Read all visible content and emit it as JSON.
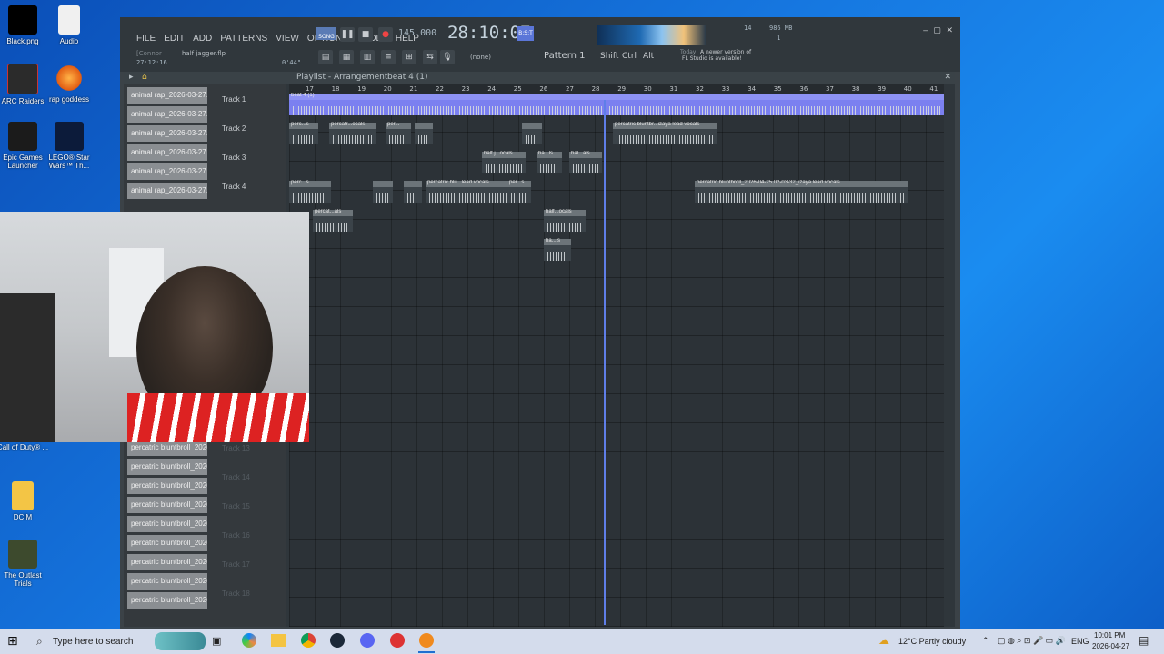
{
  "desktop": {
    "icons": [
      {
        "label": "Black.png"
      },
      {
        "label": "Audio"
      },
      {
        "label": "ARC Raiders"
      },
      {
        "label": "rap goddess"
      },
      {
        "label": "Epic Games Launcher"
      },
      {
        "label": "LEGO® Star Wars™ Th..."
      },
      {
        "label": "Call of Duty® ..."
      },
      {
        "label": "DCIM"
      },
      {
        "label": "The Outlast Trials"
      }
    ]
  },
  "flstudio": {
    "menu": [
      "FILE",
      "EDIT",
      "ADD",
      "PATTERNS",
      "VIEW",
      "OPTIONS",
      "TOOLS",
      "HELP"
    ],
    "song_label": "SONG",
    "tempo": "145.000",
    "time": "28:10:07",
    "bst": "B:S:T",
    "cpu_value": "14",
    "ram_value": "986 MB",
    "voices_value": "1",
    "user_hint": "[Connor",
    "project_file": "half jagger.flp",
    "elapsed": "27:12:16",
    "length": "0'44\"",
    "snap": "(none)",
    "pattern": "Pattern 1",
    "shift_label": "Shift",
    "ctrl_label": "Ctrl",
    "alt_label": "Alt",
    "news_prefix": "Today",
    "news_text": "A newer version of FL Studio is available!"
  },
  "playlist": {
    "title": "Playlist - Arrangement",
    "pattern_crumb": "beat 4 (1)",
    "ruler_marks": [
      "17",
      "18",
      "19",
      "20",
      "21",
      "22",
      "23",
      "24",
      "25",
      "26",
      "27",
      "28",
      "29",
      "30",
      "31",
      "32",
      "33",
      "34",
      "35",
      "36",
      "37",
      "38",
      "39",
      "40",
      "41"
    ],
    "pattern_picker": [
      "animal rap_2026-03-27...",
      "animal rap_2026-03-27...",
      "animal rap_2026-03-27...",
      "animal rap_2026-03-27...",
      "animal rap_2026-03-27...",
      "animal rap_2026-03-27...",
      "percatric bluntbroll_2026...",
      "percatric bluntbroll_2026...",
      "percatric bluntbroll_2026...",
      "percatric bluntbroll_2026...",
      "percatric bluntbroll_2026...",
      "percatric bluntbroll_2026...",
      "percatric bluntbroll_2026...",
      "percatric bluntbroll_2026...",
      "percatric bluntbroll_2026...",
      "percatric bluntbroll_2026..."
    ],
    "tracks": [
      "Track 1",
      "Track 2",
      "Track 3",
      "Track 4",
      "Track 13",
      "Track 14",
      "Track 15",
      "Track 16",
      "Track 17",
      "Track 18"
    ],
    "clips": [
      "beat 4 (1)",
      "perc...s",
      "percatr...ocals",
      "per...",
      "",
      "",
      "percatric bluntbr...izaya lead vocals",
      "half j...ocals",
      "ha...ls",
      "hal...als",
      "perc...s",
      "",
      "",
      "percatric blu...lead vocals",
      "per...s",
      "percatric bluntbroll_2026-04-25 02-03-32_izaya lead vocals",
      "percat...als",
      "half...ocals",
      "ha...ls"
    ]
  },
  "taskbar": {
    "search_placeholder": "Type here to search",
    "weather": "12°C  Partly cloudy",
    "lang": "ENG",
    "time": "10:01 PM",
    "date": "2026-04-27"
  }
}
